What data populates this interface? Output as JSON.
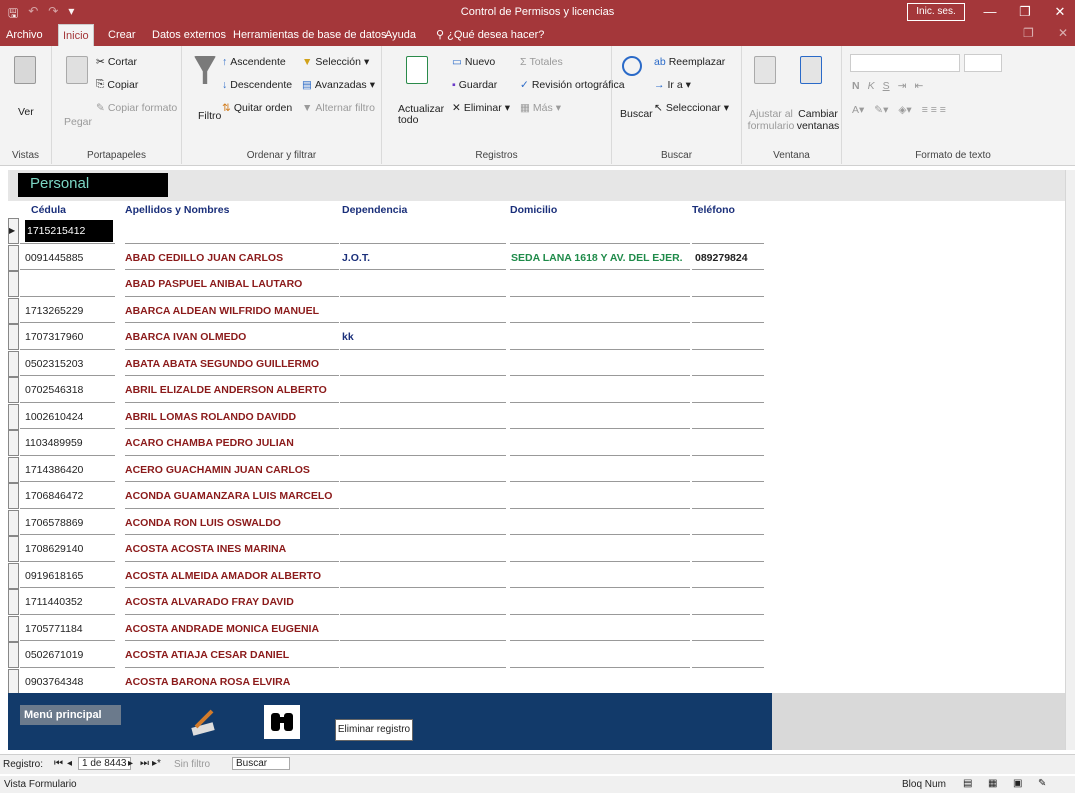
{
  "app": {
    "title": "Control de Permisos y licencias",
    "signin_label": "Inic. ses.",
    "window_buttons": [
      "—",
      "❐",
      "✕"
    ]
  },
  "tabs": [
    {
      "label": "Archivo"
    },
    {
      "label": "Inicio"
    },
    {
      "label": "Crear"
    },
    {
      "label": "Datos externos"
    },
    {
      "label": "Herramientas de base de datos"
    },
    {
      "label": "Ayuda"
    },
    {
      "label": "¿Qué desea hacer?"
    }
  ],
  "ribbon": {
    "vistas": {
      "label": "Vistas",
      "ver": "Ver"
    },
    "portapapeles": {
      "label": "Portapapeles",
      "pegar": "Pegar",
      "cortar": "Cortar",
      "copiar": "Copiar",
      "copiar_formato": "Copiar formato"
    },
    "ordenar": {
      "label": "Ordenar y filtrar",
      "filtro": "Filtro",
      "ascendente": "Ascendente",
      "descendente": "Descendente",
      "quitar_orden": "Quitar orden",
      "seleccion": "Selección",
      "avanzadas": "Avanzadas",
      "alternar_filtro": "Alternar filtro"
    },
    "registros": {
      "label": "Registros",
      "actualizar": "Actualizar todo",
      "nuevo": "Nuevo",
      "guardar": "Guardar",
      "eliminar": "Eliminar",
      "totales": "Totales",
      "revision": "Revisión ortográfica",
      "mas": "Más"
    },
    "buscar": {
      "label": "Buscar",
      "buscar": "Buscar",
      "reemplazar": "Reemplazar",
      "ir_a": "Ir a",
      "seleccionar": "Seleccionar"
    },
    "ventana": {
      "label": "Ventana",
      "ajustar": "Ajustar al formulario",
      "cambiar": "Cambiar ventanas"
    },
    "formato": {
      "label": "Formato de texto",
      "bold": "N",
      "italic": "K",
      "underline": "S"
    }
  },
  "form": {
    "title": "Personal",
    "headers": {
      "cedula": "Cédula",
      "nombres": "Apellidos y Nombres",
      "dependencia": "Dependencia",
      "domicilio": "Domicilio",
      "telefono": "Teléfono"
    },
    "rows": [
      {
        "cedula": "1715215412",
        "nombres": "",
        "dependencia": "",
        "domicilio": "",
        "telefono": ""
      },
      {
        "cedula": "0091445885",
        "nombres": "ABAD CEDILLO JUAN CARLOS",
        "dependencia": "J.O.T.",
        "domicilio": "SEDA LANA 1618 Y AV. DEL EJER.",
        "telefono": "089279824"
      },
      {
        "cedula": "",
        "nombres": "ABAD PASPUEL ANIBAL LAUTARO",
        "dependencia": "",
        "domicilio": "",
        "telefono": ""
      },
      {
        "cedula": "1713265229",
        "nombres": "ABARCA ALDEAN WILFRIDO MANUEL",
        "dependencia": "",
        "domicilio": "",
        "telefono": ""
      },
      {
        "cedula": "1707317960",
        "nombres": "ABARCA IVAN OLMEDO",
        "dependencia": "kk",
        "domicilio": "",
        "telefono": ""
      },
      {
        "cedula": "0502315203",
        "nombres": "ABATA ABATA SEGUNDO GUILLERMO",
        "dependencia": "",
        "domicilio": "",
        "telefono": ""
      },
      {
        "cedula": "0702546318",
        "nombres": "ABRIL ELIZALDE ANDERSON ALBERTO",
        "dependencia": "",
        "domicilio": "",
        "telefono": ""
      },
      {
        "cedula": "1002610424",
        "nombres": "ABRIL LOMAS ROLANDO DAVIDD",
        "dependencia": "",
        "domicilio": "",
        "telefono": ""
      },
      {
        "cedula": "1103489959",
        "nombres": "ACARO CHAMBA PEDRO JULIAN",
        "dependencia": "",
        "domicilio": "",
        "telefono": ""
      },
      {
        "cedula": "1714386420",
        "nombres": "ACERO GUACHAMIN JUAN CARLOS",
        "dependencia": "",
        "domicilio": "",
        "telefono": ""
      },
      {
        "cedula": "1706846472",
        "nombres": "ACONDA GUAMANZARA LUIS MARCELO",
        "dependencia": "",
        "domicilio": "",
        "telefono": ""
      },
      {
        "cedula": "1706578869",
        "nombres": "ACONDA RON LUIS OSWALDO",
        "dependencia": "",
        "domicilio": "",
        "telefono": ""
      },
      {
        "cedula": "1708629140",
        "nombres": "ACOSTA ACOSTA INES MARINA",
        "dependencia": "",
        "domicilio": "",
        "telefono": ""
      },
      {
        "cedula": "0919618165",
        "nombres": "ACOSTA ALMEIDA AMADOR ALBERTO",
        "dependencia": "",
        "domicilio": "",
        "telefono": ""
      },
      {
        "cedula": "1711440352",
        "nombres": "ACOSTA ALVARADO FRAY DAVID",
        "dependencia": "",
        "domicilio": "",
        "telefono": ""
      },
      {
        "cedula": "1705771184",
        "nombres": "ACOSTA ANDRADE MONICA EUGENIA",
        "dependencia": "",
        "domicilio": "",
        "telefono": ""
      },
      {
        "cedula": "0502671019",
        "nombres": "ACOSTA ATIAJA CESAR DANIEL",
        "dependencia": "",
        "domicilio": "",
        "telefono": ""
      },
      {
        "cedula": "0903764348",
        "nombres": "ACOSTA BARONA ROSA ELVIRA",
        "dependencia": "",
        "domicilio": "",
        "telefono": ""
      }
    ],
    "footer": {
      "menu_principal": "Menú principal",
      "eliminar_registro": "Eliminar registro"
    }
  },
  "navigation": {
    "registro_label": "Registro:",
    "position": "1 de 8443",
    "filter": "Sin filtro",
    "search": "Buscar"
  },
  "status": {
    "left": "Vista Formulario",
    "right": "Bloq Num"
  },
  "colors": {
    "accent": "#a4373a",
    "footer": "#123a6a",
    "names": "#8b1a1a",
    "dependencia": "#1a2f7a",
    "domicilio": "#1f8b4a"
  }
}
